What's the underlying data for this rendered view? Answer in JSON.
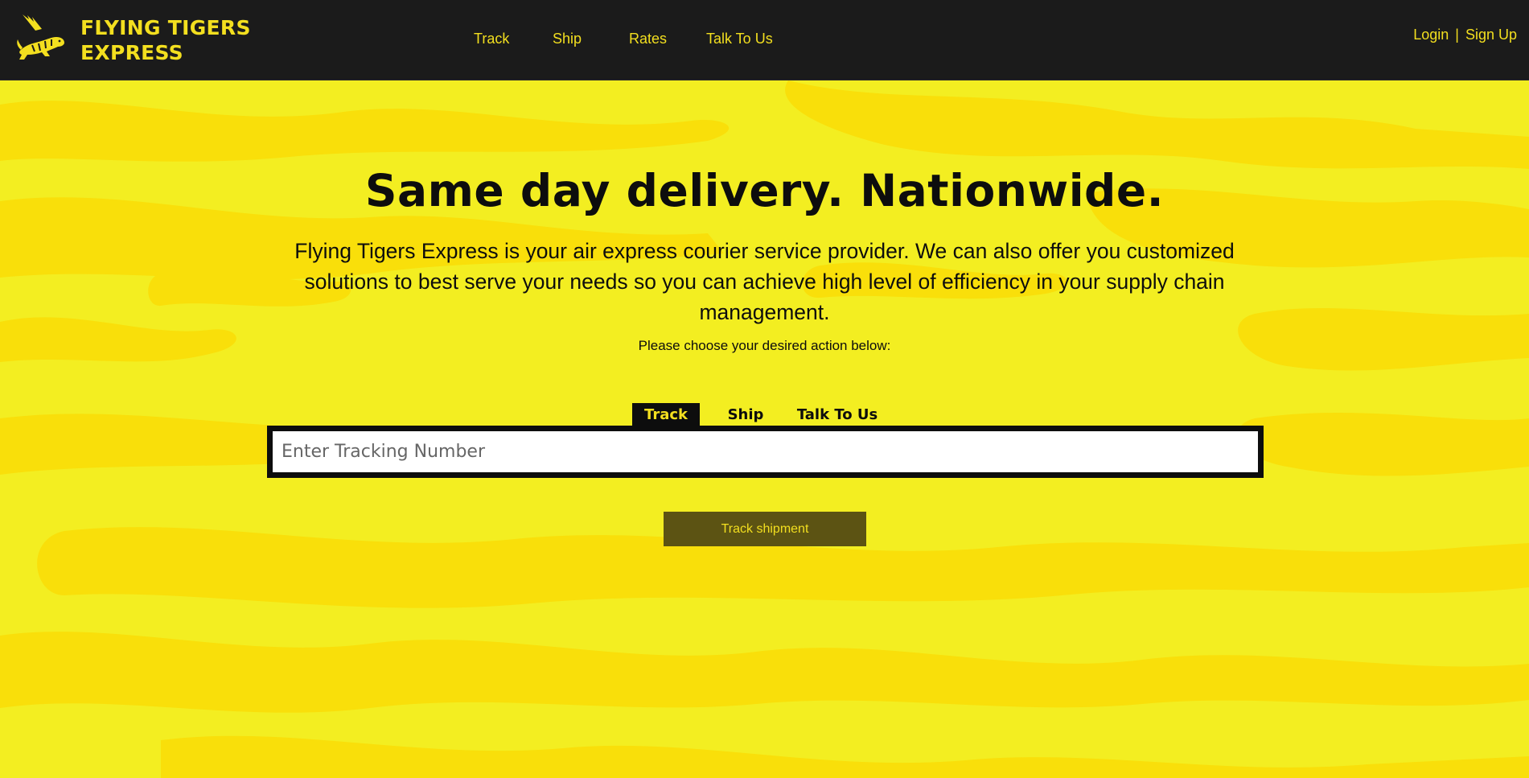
{
  "header": {
    "logo_line1": "FLYING TIGERS",
    "logo_line2": "EXPRESS",
    "logo_icon": "flying-tiger-icon",
    "nav": [
      {
        "label": "Track"
      },
      {
        "label": "Ship"
      },
      {
        "label": "Rates"
      },
      {
        "label": "Talk To Us"
      }
    ],
    "login_label": "Login",
    "separator": "|",
    "signup_label": "Sign Up"
  },
  "hero": {
    "headline": "Same day delivery. Nationwide.",
    "intro": "Flying Tigers Express is your air express courier service provider. We can also offer you customized solutions to best serve your needs so you can achieve high level of efficiency in your supply chain management.",
    "prompt": "Please choose your desired action below:",
    "tabs": [
      {
        "label": "Track",
        "active": true
      },
      {
        "label": "Ship",
        "active": false
      },
      {
        "label": "Talk To Us",
        "active": false
      }
    ],
    "tracking_placeholder": "Enter Tracking Number",
    "tracking_value": "",
    "submit_label": "Track shipment"
  },
  "colors": {
    "header_bg": "#1b1b1b",
    "brand_yellow": "#f3df1f",
    "hero_light": "#f3ee21",
    "hero_stripe": "#f9df0a",
    "button_bg": "#5c5313",
    "text_dark": "#0d0d0d"
  }
}
